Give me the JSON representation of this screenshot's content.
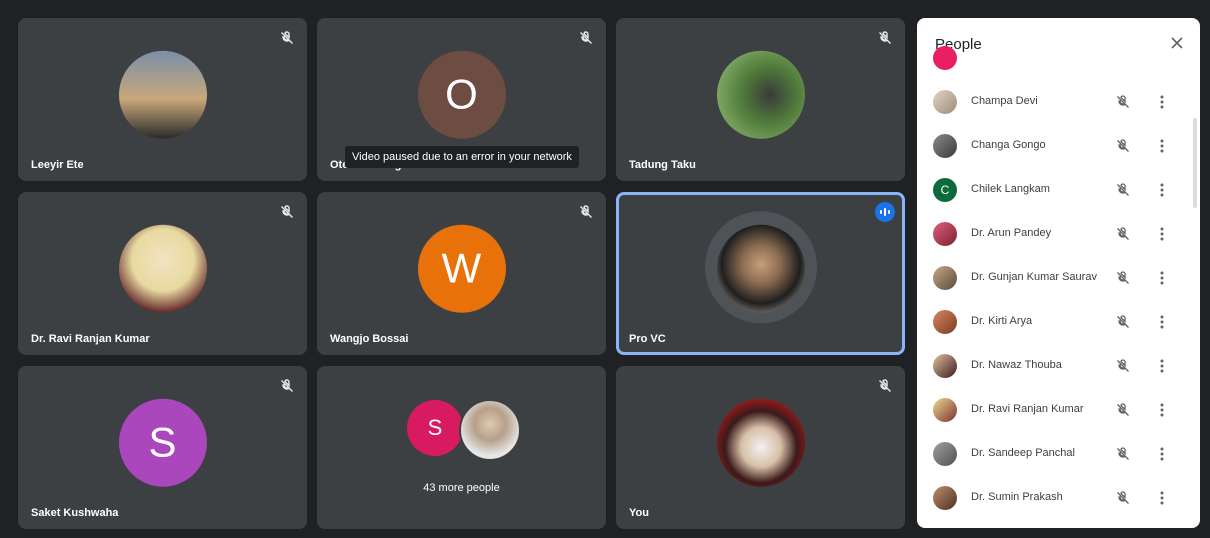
{
  "tiles": [
    {
      "name": "Leeyir Ete"
    },
    {
      "name": "Otem Padung",
      "initial": "O",
      "tooltip": "Video paused due to an error in your network"
    },
    {
      "name": "Tadung Taku"
    },
    {
      "name": "Dr. Ravi Ranjan Kumar"
    },
    {
      "name": "Wangjo Bossai",
      "initial": "W"
    },
    {
      "name": "Pro VC"
    },
    {
      "name": "Saket Kushwaha",
      "initial": "S"
    },
    {
      "more_initial": "S",
      "more_label": "43 more people"
    },
    {
      "name": "You"
    }
  ],
  "panel": {
    "title": "People",
    "people": [
      {
        "name": "Champa Devi"
      },
      {
        "name": "Changa Gongo"
      },
      {
        "name": "Chilek Langkam",
        "initial": "C"
      },
      {
        "name": "Dr. Arun Pandey"
      },
      {
        "name": "Dr. Gunjan Kumar Saurav"
      },
      {
        "name": "Dr. Kirti Arya"
      },
      {
        "name": "Dr. Nawaz Thouba"
      },
      {
        "name": "Dr. Ravi Ranjan Kumar"
      },
      {
        "name": "Dr. Sandeep Panchal"
      },
      {
        "name": "Dr. Sumin Prakash"
      }
    ]
  },
  "colors": {
    "tile_bg": "#3c4043",
    "accent": "#8ab4f8",
    "avatar_o": "#6d4c41",
    "avatar_w": "#e8710a",
    "avatar_s": "#ab47bc",
    "avatar_s_small": "#d81b60",
    "avatar_c": "#0b6b3a"
  }
}
